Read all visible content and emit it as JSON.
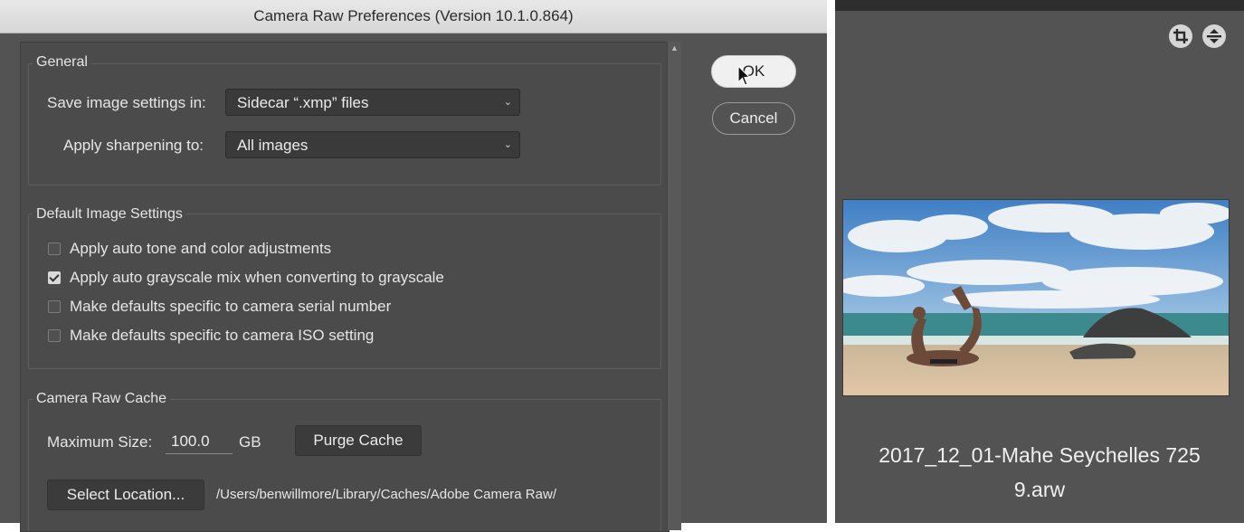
{
  "dialog": {
    "title": "Camera Raw Preferences  (Version 10.1.0.864)",
    "ok_label": "OK",
    "cancel_label": "Cancel"
  },
  "general": {
    "title": "General",
    "save_label": "Save image settings in:",
    "save_value": "Sidecar “.xmp” files",
    "sharpen_label": "Apply sharpening to:",
    "sharpen_value": "All images"
  },
  "defaults": {
    "title": "Default Image Settings",
    "options": [
      {
        "label": "Apply auto tone and color adjustments",
        "checked": false
      },
      {
        "label": "Apply auto grayscale mix when converting to grayscale",
        "checked": true
      },
      {
        "label": "Make defaults specific to camera serial number",
        "checked": false
      },
      {
        "label": "Make defaults specific to camera ISO setting",
        "checked": false
      }
    ]
  },
  "cache": {
    "title": "Camera Raw Cache",
    "max_size_label": "Maximum Size:",
    "max_size_value": "100.0",
    "unit": "GB",
    "purge_label": "Purge Cache",
    "select_location_label": "Select Location...",
    "path": "/Users/benwillmore/Library/Caches/Adobe Camera Raw/"
  },
  "filmstrip": {
    "filename_line1": "2017_12_01-Mahe Seychelles 725",
    "filename_line2": "9.arw",
    "icons": [
      "crop-icon",
      "straighten-icon"
    ]
  },
  "colors": {
    "dialog_bg": "#535353",
    "panel_bg": "#4b4b4b",
    "button_dark": "#3b3b3b",
    "ok_fill": "#f0f0f0"
  }
}
